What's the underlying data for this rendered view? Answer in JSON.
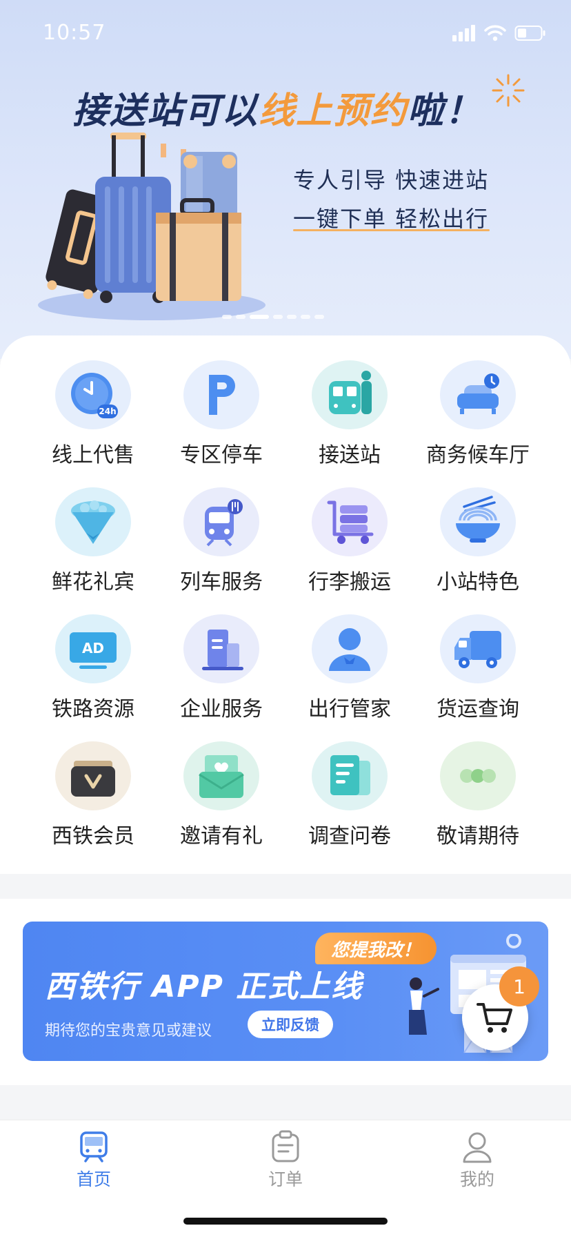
{
  "status_bar": {
    "time": "10:57"
  },
  "hero": {
    "title_part1": "接送站可以",
    "title_highlight": "线上预约",
    "title_part2": "啦！",
    "subtitle_line1": "专人引导 快速进站",
    "subtitle_line2": "一键下单 轻松出行",
    "carousel_total": 7,
    "carousel_active": 2
  },
  "services": [
    {
      "label": "线上代售",
      "icon": "clock-24h-icon"
    },
    {
      "label": "专区停车",
      "icon": "parking-icon"
    },
    {
      "label": "接送站",
      "icon": "station-pickup-icon"
    },
    {
      "label": "商务候车厅",
      "icon": "business-lounge-icon"
    },
    {
      "label": "鲜花礼宾",
      "icon": "flower-bouquet-icon"
    },
    {
      "label": "列车服务",
      "icon": "train-service-icon"
    },
    {
      "label": "行李搬运",
      "icon": "luggage-cart-icon"
    },
    {
      "label": "小站特色",
      "icon": "noodle-bowl-icon"
    },
    {
      "label": "铁路资源",
      "icon": "ad-screen-icon"
    },
    {
      "label": "企业服务",
      "icon": "building-icon"
    },
    {
      "label": "出行管家",
      "icon": "butler-icon"
    },
    {
      "label": "货运查询",
      "icon": "truck-icon"
    },
    {
      "label": "西铁会员",
      "icon": "vip-wallet-icon"
    },
    {
      "label": "邀请有礼",
      "icon": "invite-envelope-icon"
    },
    {
      "label": "调查问卷",
      "icon": "survey-doc-icon"
    },
    {
      "label": "敬请期待",
      "icon": "more-dots-icon"
    }
  ],
  "promo": {
    "title": "西铁行 APP 正式上线",
    "subtitle": "期待您的宝贵意见或建议",
    "button": "立即反馈",
    "tag": "您提我改！"
  },
  "cart": {
    "badge": "1"
  },
  "tabbar": {
    "items": [
      {
        "label": "首页",
        "icon": "train-home-icon",
        "active": true
      },
      {
        "label": "订单",
        "icon": "clipboard-icon",
        "active": false
      },
      {
        "label": "我的",
        "icon": "user-icon",
        "active": false
      }
    ]
  },
  "colors": {
    "accent": "#3f7de8",
    "highlight": "#f39a3c",
    "promo_bg": "#5a8ff5",
    "badge": "#f5943b"
  }
}
